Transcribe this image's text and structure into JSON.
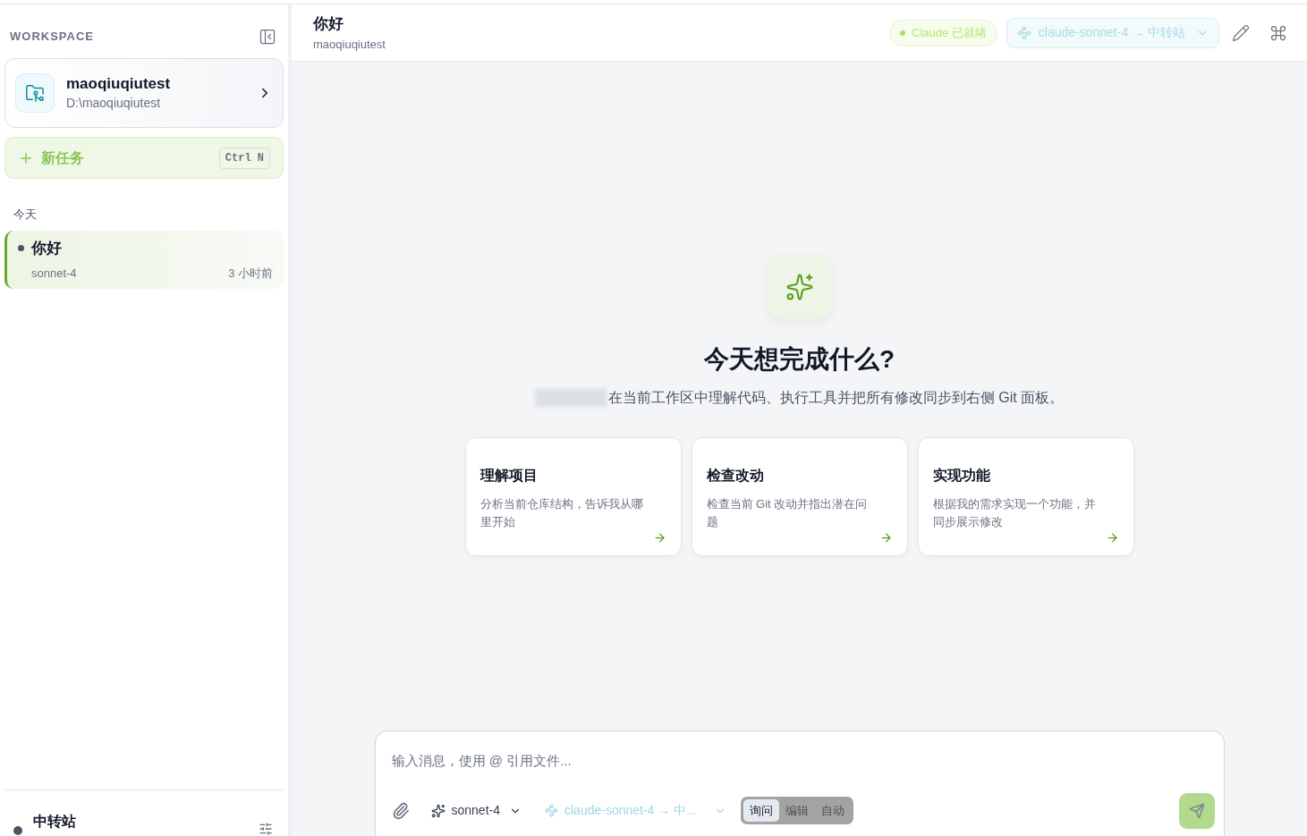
{
  "sidebar": {
    "heading": "WORKSPACE",
    "workspace": {
      "name": "maoqiuqiutest",
      "path": "D:\\maoqiuqiutest"
    },
    "new_task": {
      "label": "新任务",
      "shortcut": "Ctrl N",
      "disabled": true
    },
    "groups": [
      {
        "label": "今天",
        "sessions": [
          {
            "title": "你好",
            "model": "sonnet-4",
            "time": "3 小时前",
            "selected": true
          }
        ]
      }
    ],
    "footer": {
      "title": "中转站"
    }
  },
  "header": {
    "title": "你好",
    "subtitle": "maoqiuqiutest",
    "status": "Claude 已就绪",
    "route": "claude-sonnet-4 → 中转站"
  },
  "hero": {
    "title": "今天想完成什么?",
    "subtitle": "在当前工作区中理解代码、执行工具并把所有修改同步到右侧 Git 面板。"
  },
  "cards": [
    {
      "title": "理解项目",
      "text": "分析当前仓库结构，告诉我从哪里开始"
    },
    {
      "title": "检查改动",
      "text": "检查当前 Git 改动并指出潜在问题"
    },
    {
      "title": "实现功能",
      "text": "根据我的需求实现一个功能，并同步展示修改"
    }
  ],
  "composer": {
    "placeholder": "输入消息，使用 @ 引用文件...",
    "model": "sonnet-4",
    "route": "claude-sonnet-4 → 中...",
    "modes": [
      {
        "label": "询问",
        "selected": true
      },
      {
        "label": "编辑",
        "selected": false
      },
      {
        "label": "自动",
        "selected": false
      }
    ]
  }
}
